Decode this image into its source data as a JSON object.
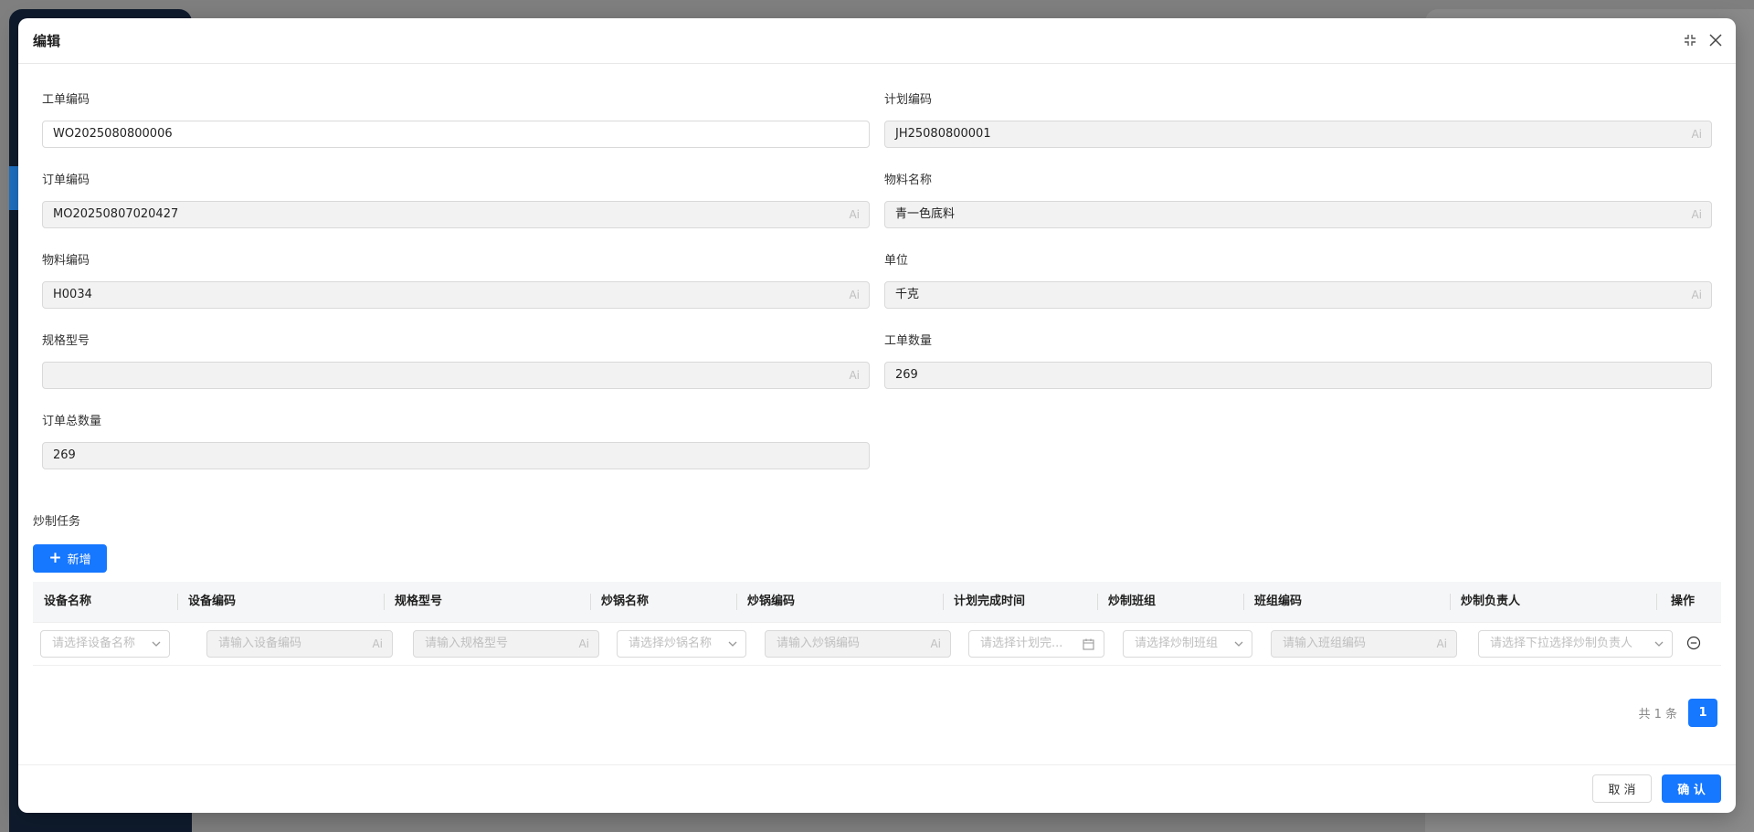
{
  "modal": {
    "title": "编辑",
    "fullscreen_icon": "fullscreen-icon",
    "close_icon": "close-icon"
  },
  "form": {
    "work_order_code": {
      "label": "工单编码",
      "value": "WO2025080800006",
      "disabled": false
    },
    "plan_code": {
      "label": "计划编码",
      "value": "JH25080800001",
      "disabled": true,
      "suffix": "Ai"
    },
    "order_code": {
      "label": "订单编码",
      "value": "MO20250807020427",
      "disabled": true,
      "suffix": "Ai"
    },
    "material_name": {
      "label": "物料名称",
      "value": "青一色底料",
      "disabled": true,
      "suffix": "Ai"
    },
    "material_code": {
      "label": "物料编码",
      "value": "H0034",
      "disabled": true,
      "suffix": "Ai"
    },
    "unit": {
      "label": "单位",
      "value": "千克",
      "disabled": true,
      "suffix": "Ai"
    },
    "spec_model": {
      "label": "规格型号",
      "value": "",
      "disabled": true,
      "suffix": "Ai"
    },
    "work_order_qty": {
      "label": "工单数量",
      "value": "269",
      "disabled": true
    },
    "order_total_qty": {
      "label": "订单总数量",
      "value": "269",
      "disabled": true
    }
  },
  "tasks": {
    "section_title": "炒制任务",
    "add_button_label": "新增",
    "columns": [
      "设备名称",
      "设备编码",
      "规格型号",
      "炒锅名称",
      "炒锅编码",
      "计划完成时间",
      "炒制班组",
      "班组编码",
      "炒制负责人",
      "操作"
    ],
    "row_placeholders": {
      "device_name": "请选择设备名称",
      "device_code": "请输入设备编码",
      "spec_model": "请输入规格型号",
      "wok_name": "请选择炒锅名称",
      "wok_code": "请输入炒锅编码",
      "plan_finish_time": "请选择计划完...",
      "team": "请选择炒制班组",
      "team_code": "请输入班组编码",
      "owner": "请选择下拉选择炒制负责人"
    },
    "suffix": "Ai"
  },
  "pagination": {
    "total_text": "共 1 条",
    "current_page": "1"
  },
  "footer": {
    "cancel_label": "取 消",
    "confirm_label": "确 认"
  },
  "colors": {
    "primary": "#1677ff",
    "overlay": "#7f7f7f"
  }
}
